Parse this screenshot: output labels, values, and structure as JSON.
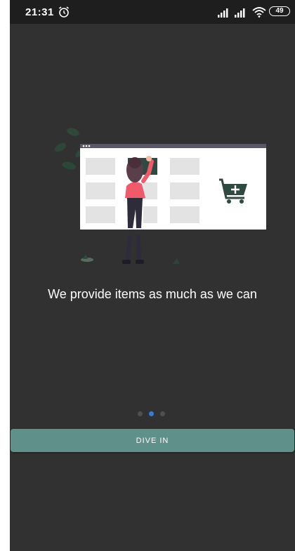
{
  "status_bar": {
    "time": "21:31",
    "battery": "49",
    "icons": [
      "alarm-icon",
      "signal-icon",
      "signal-icon",
      "wifi-icon",
      "battery-icon"
    ]
  },
  "onboarding": {
    "illustration": "shopping-illustration",
    "headline": "We provide items as much as we can",
    "pager": {
      "total": 3,
      "active_index": 1
    },
    "cta_label": "DIVE IN"
  },
  "colors": {
    "background": "#313131",
    "status_bar": "#1e1e1e",
    "accent_dot": "#3a7bd5",
    "button": "#5f918a",
    "figure": "#f05a6b"
  }
}
